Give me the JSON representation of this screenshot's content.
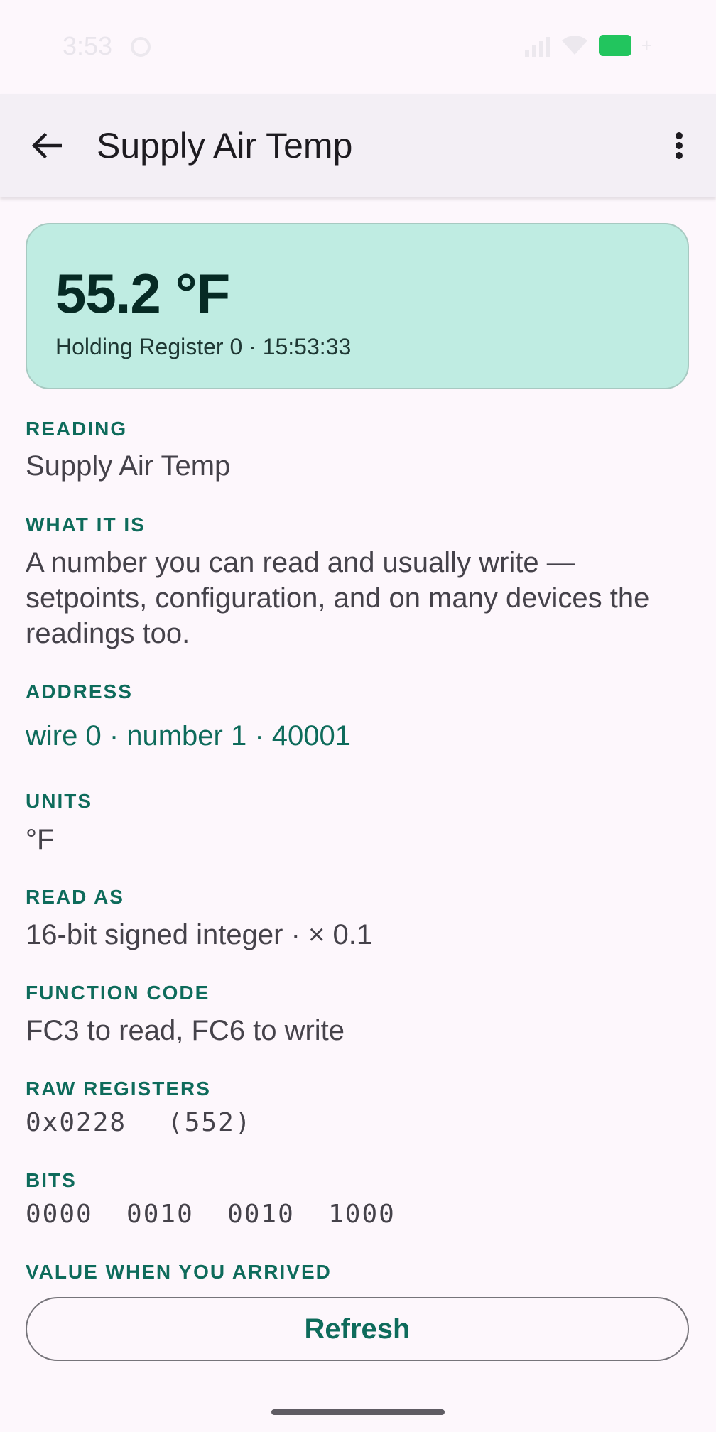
{
  "status_bar": {
    "time": "3:53"
  },
  "app_bar": {
    "title": "Supply Air Temp"
  },
  "value_card": {
    "value": "55.2 °F",
    "subtitle": "Holding Register 0 · 15:53:33"
  },
  "fields": {
    "reading_label": "READING",
    "reading_value": "Supply Air Temp",
    "what_label": "WHAT IT IS",
    "what_value": "A number you can read and usually write — setpoints, configuration, and on many devices the readings too.",
    "address_label": "ADDRESS",
    "address_value": "wire 0 · number 1 · 40001",
    "units_label": "UNITS",
    "units_value": "°F",
    "readas_label": "READ AS",
    "readas_value": "16-bit signed integer · × 0.1",
    "fc_label": "FUNCTION CODE",
    "fc_value": "FC3 to read, FC6 to write",
    "raw_label": "RAW REGISTERS",
    "raw_hex": "0x0228",
    "raw_dec": "(552)",
    "bits_label": "BITS",
    "bits_value": "0000  0010  0010  1000",
    "arrived_label": "VALUE WHEN YOU ARRIVED"
  },
  "actions": {
    "refresh_label": "Refresh"
  },
  "colors": {
    "accent": "#0e6b5b",
    "card": "#bfece2",
    "background": "#fdf7fc"
  }
}
